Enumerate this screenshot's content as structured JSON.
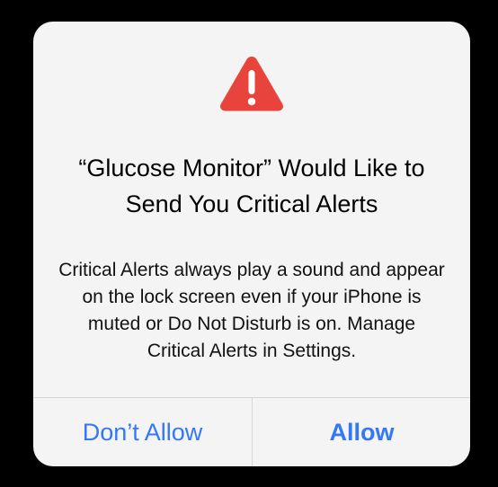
{
  "alert": {
    "icon": "warning-triangle-icon",
    "icon_color": "#e9443b",
    "title": "“Glucose Monitor” Would Like to Send You Critical Alerts",
    "message": "Critical Alerts always play a sound and appear on the lock screen even if your iPhone is muted or Do Not Disturb is on. Manage Critical Alerts in Settings.",
    "buttons": {
      "deny_label": "Don’t Allow",
      "allow_label": "Allow"
    },
    "accent_color": "#3478f6"
  }
}
